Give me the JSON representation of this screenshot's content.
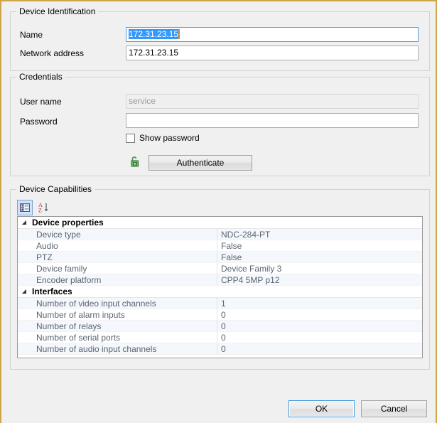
{
  "window": {
    "border_color": "#cfa54a",
    "background": "#f0f0f0"
  },
  "device_identification": {
    "legend": "Device Identification",
    "name_label": "Name",
    "name_value": "172.31.23.15",
    "name_selected": true,
    "network_address_label": "Network address",
    "network_address_value": "172.31.23.15"
  },
  "credentials": {
    "legend": "Credentials",
    "username_label": "User name",
    "username_value": "service",
    "username_disabled": true,
    "password_label": "Password",
    "password_value": "",
    "show_password_label": "Show password",
    "show_password_checked": false,
    "authenticate_label": "Authenticate",
    "lock_icon": "open-padlock-icon",
    "lock_icon_color": "#3f9b3f"
  },
  "device_capabilities": {
    "legend": "Device Capabilities",
    "toolbar": {
      "categorized_icon": "categorized-view-icon",
      "categorized_pressed": true,
      "alphabetical_icon": "alphabetical-sort-icon",
      "alphabetical_pressed": false
    },
    "groups": [
      {
        "name": "Device properties",
        "expanded": true,
        "rows": [
          {
            "name": "Device type",
            "value": "NDC-284-PT"
          },
          {
            "name": "Audio",
            "value": "False"
          },
          {
            "name": "PTZ",
            "value": "False"
          },
          {
            "name": "Device family",
            "value": "Device Family 3"
          },
          {
            "name": "Encoder platform",
            "value": "CPP4 5MP p12"
          }
        ]
      },
      {
        "name": "Interfaces",
        "expanded": true,
        "rows": [
          {
            "name": "Number of video input channels",
            "value": "1"
          },
          {
            "name": "Number of alarm inputs",
            "value": "0"
          },
          {
            "name": "Number of relays",
            "value": "0"
          },
          {
            "name": "Number of serial ports",
            "value": "0"
          },
          {
            "name": "Number of audio input channels",
            "value": "0"
          }
        ]
      }
    ]
  },
  "footer": {
    "ok_label": "OK",
    "cancel_label": "Cancel",
    "default_button": "OK",
    "accent_color": "#3c9bde"
  }
}
